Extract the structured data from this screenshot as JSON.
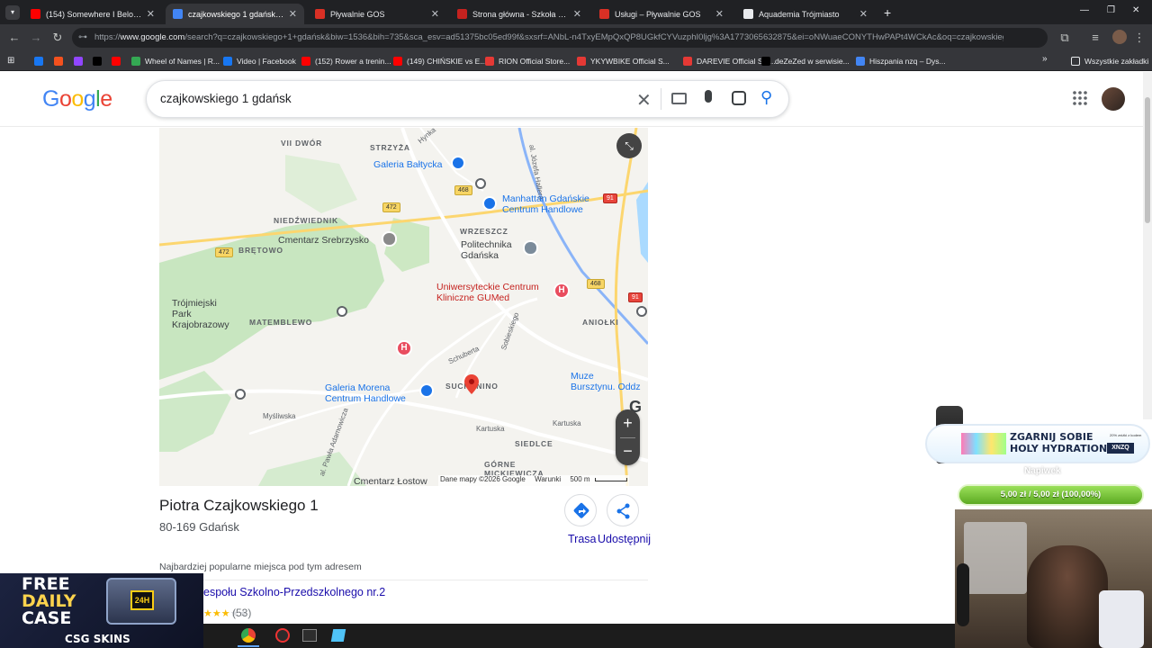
{
  "browser": {
    "tabs": [
      {
        "title": "(154) Somewhere I Belong (Offi",
        "favicon": "youtube",
        "color": "#ff0000",
        "active": false
      },
      {
        "title": "czajkowskiego 1 gdańsk - Szuk",
        "favicon": "google",
        "color": "#4285f4",
        "active": true
      },
      {
        "title": "Pływalnie GOS",
        "favicon": "gos",
        "color": "#d93025",
        "active": false
      },
      {
        "title": "Strona główna - Szkoła Podstaw",
        "favicon": "school",
        "color": "#c5221f",
        "active": false
      },
      {
        "title": "Usługi – Pływalnie GOS",
        "favicon": "gos",
        "color": "#d93025",
        "active": false
      },
      {
        "title": "Aquademia Trójmiasto",
        "favicon": "aquademia",
        "color": "#e8eaed",
        "active": false
      }
    ],
    "new_tab": "+",
    "window_controls": {
      "minimize": "—",
      "maximize": "❐",
      "close": "✕"
    },
    "url_prefix": "https://",
    "url_host": "www.google.com",
    "url_rest": "/search?q=czajkowskiego+1+gdańsk&biw=1536&bih=735&sca_esv=ad51375bc05ed99f&sxsrf=ANbL-n4TxyEMpQxQP8UGkfCYVuzphI0ljg%3A1773065632875&ei=oNWuaeCONYTHwPAPt4WCkAc&oq=czajkowskiego+1...",
    "bookmarks": [
      {
        "label": "",
        "color": "#1877f2"
      },
      {
        "label": "",
        "color": "#f4511e"
      },
      {
        "label": "",
        "color": "#9146ff"
      },
      {
        "label": "",
        "color": "#000000"
      },
      {
        "label": "",
        "color": "#ff0000"
      },
      {
        "label": "Wheel of Names | R...",
        "color": "#34a853"
      },
      {
        "label": "Video | Facebook",
        "color": "#1877f2"
      },
      {
        "label": "(152) Rower a trenin...",
        "color": "#ff0000"
      },
      {
        "label": "(149) CHIŃSKIE vs E...",
        "color": "#ff0000"
      },
      {
        "label": "RION Official Store...",
        "color": "#e53935"
      },
      {
        "label": "YKYWBIKE Official S...",
        "color": "#e53935"
      },
      {
        "label": "DAREVIE Official Sto...",
        "color": "#e53935"
      },
      {
        "label": "deZeZed w serwisie...",
        "color": "#000000"
      },
      {
        "label": "Hiszpania nzq – Dys...",
        "color": "#4285f4"
      }
    ],
    "all_bookmarks": "Wszystkie zakładki"
  },
  "google": {
    "logo_letters": [
      "G",
      "o",
      "o",
      "g",
      "l",
      "e"
    ],
    "logo_colors": [
      "#4285f4",
      "#ea4335",
      "#fbbc05",
      "#4285f4",
      "#34a853",
      "#ea4335"
    ],
    "query": "czajkowskiego 1 gdańsk"
  },
  "map": {
    "labels": {
      "vii_dwor": "VII DWÓR",
      "strzyza": "STRZYŻA",
      "hynka": "Hynka",
      "galeria_baltycka": "Galeria Bałtycka",
      "jozefa_hallera": "al. Józefa Hallera",
      "manhattan": "Manhattan Gdańskie\nCentrum Handlowe",
      "niedzwiednik": "NIEDŹWIEDNIK",
      "wrzeszcz": "WRZESZCZ",
      "cmentarz": "Cmentarz Srebrzysko",
      "bretowo": "BRĘTOWO",
      "politechnika": "Politechnika\nGdańska",
      "uck": "Uniwersyteckie Centrum\nKliniczne GUMed",
      "trojmiejski_park": "Trójmiejski\nPark\nKrajobrazowy",
      "matemblewo": "MATEMBLEWO",
      "aniolki": "ANIOŁKI",
      "sobieskiego": "Sobieskiego",
      "schuberta": "Schuberta",
      "galeria_morena": "Galeria Morena\nCentrum Handlowe",
      "suchanino": "SUCHANINO",
      "muzeum": "Muze\nBursztynu. Oddz",
      "mysliwska": "Myśliwska",
      "adamowicza": "al. Pawła Adamowicza",
      "kartuska1": "Kartuska",
      "kartuska2": "Kartuska",
      "siedlce": "SIEDLCE",
      "cmentarz_lostow": "Cmentarz Łostow",
      "mickiewicza": "GÓRNE\nMICKIEWICZA",
      "g_label": "G"
    },
    "badges": [
      "468",
      "472",
      "472",
      "91",
      "468",
      "91"
    ],
    "attribution": "Dane mapy ©2026 Google",
    "terms": "Warunki",
    "scale": "500 m",
    "zoom_in": "+",
    "zoom_out": "−"
  },
  "place": {
    "name": "Piotra Czajkowskiego 1",
    "postal": "80-169 Gdańsk",
    "actions": [
      {
        "label": "Trasa"
      },
      {
        "label": "Udostępnij"
      }
    ],
    "popular_heading": "Najbardziej popularne miejsca pod tym adresem",
    "result_title": "espołu Szkolno-Przedszkolnego nr.2",
    "result_rating_count": "(53)",
    "result_stars": 3
  },
  "overlays": {
    "case_ad": {
      "line1": "FREE",
      "line2": "DAILY",
      "line3": "CASE",
      "brand": "CSG SKINS",
      "badge": "24H"
    },
    "tip": {
      "headline1": "ZGARNIJ SOBIE",
      "headline2": "HOLY HYDRATION",
      "code": "XNZQ",
      "small": "20% zniżki z kodem",
      "label": "Napiwek",
      "bar": "5,00 zł / 5,00 zł (100,00%)",
      "progress": 1.0
    }
  }
}
